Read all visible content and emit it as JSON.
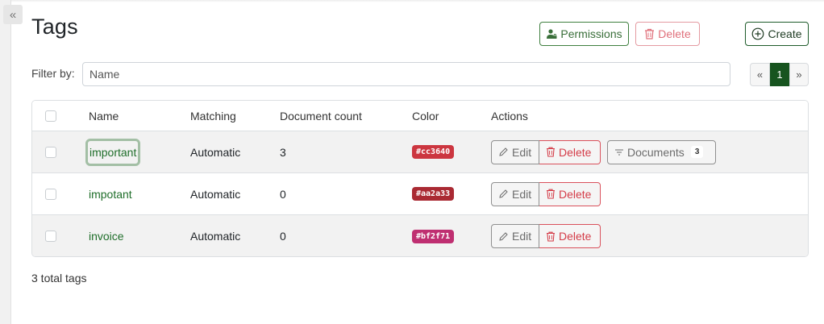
{
  "sidebar": {
    "collapse_label": "«"
  },
  "page": {
    "title": "Tags"
  },
  "toolbar": {
    "permissions_label": "Permissions",
    "delete_label": "Delete",
    "create_label": "Create"
  },
  "filter": {
    "label": "Filter by:",
    "placeholder": "Name",
    "value": ""
  },
  "pagination": {
    "prev": "«",
    "current": "1",
    "next": "»"
  },
  "table": {
    "columns": [
      "Name",
      "Matching",
      "Document count",
      "Color",
      "Actions"
    ],
    "rows": [
      {
        "name": "important",
        "matching": "Automatic",
        "count": "3",
        "color_label": "#cc3640",
        "color": "#cc3640",
        "edit": "Edit",
        "delete": "Delete",
        "documents": "Documents",
        "documents_count": "3"
      },
      {
        "name": "impotant",
        "matching": "Automatic",
        "count": "0",
        "color_label": "#aa2a33",
        "color": "#aa2a33",
        "edit": "Edit",
        "delete": "Delete"
      },
      {
        "name": "invoice",
        "matching": "Automatic",
        "count": "0",
        "color_label": "#bf2f71",
        "color": "#bf2f71",
        "edit": "Edit",
        "delete": "Delete"
      }
    ]
  },
  "footer": {
    "total_text": "3 total tags"
  },
  "colors": {
    "primary": "#17541f",
    "danger": "#d43c48"
  }
}
